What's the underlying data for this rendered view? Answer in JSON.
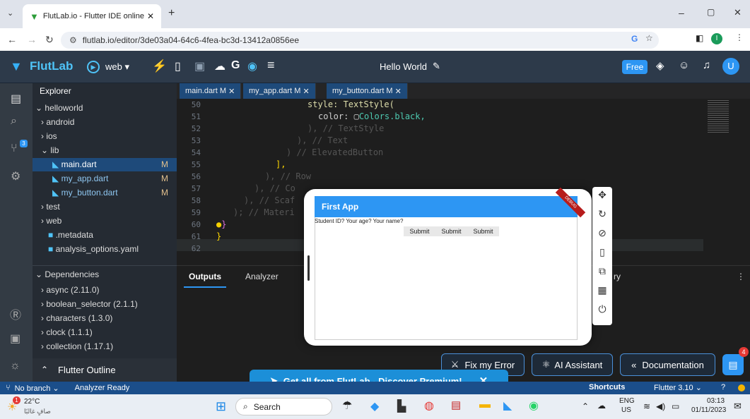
{
  "browser": {
    "tab_title": "FlutLab.io - Flutter IDE online",
    "url": "flutlab.io/editor/3de03a04-64c6-4fea-bc3d-13412a0856ee"
  },
  "app": {
    "brand": "FlutLab",
    "target": "web",
    "project_title": "Hello World",
    "plan": "Free",
    "avatar": "U"
  },
  "explorer": {
    "title": "Explorer",
    "root": "helloworld",
    "items": [
      "android",
      "ios",
      "lib",
      "main.dart",
      "my_app.dart",
      "my_button.dart",
      "test",
      "web",
      ".metadata",
      "analysis_options.yaml"
    ],
    "modified_flag": "M"
  },
  "dependencies": {
    "title": "Dependencies",
    "items": [
      "async (2.11.0)",
      "boolean_selector (2.1.1)",
      "characters (1.3.0)",
      "clock (1.1.1)",
      "collection (1.17.1)"
    ]
  },
  "outline": {
    "title": "Flutter Outline"
  },
  "editor_tabs": [
    "main.dart M",
    "my_app.dart M",
    "my_button.dart M"
  ],
  "code": {
    "lines": [
      "50",
      "51",
      "52",
      "53",
      "54",
      "55",
      "56",
      "57",
      "58",
      "59",
      "60",
      "61",
      "62"
    ],
    "l50": "style: TextStyle(",
    "l51a": "color: ",
    "l51b": "Colors.black,",
    "l52": "), // TextStyle",
    "l53": "), // Text",
    "l54": ") // ElevatedButton",
    "l55": "],",
    "l56": "), // Row",
    "l57": "), // Co",
    "l58": "), // Scaf",
    "l59": "); // Materi",
    "l60": "}",
    "l61": "}"
  },
  "bottom_tabs": {
    "outputs": "Outputs",
    "analyzer": "Analyzer",
    "other_tail": "ry"
  },
  "preview": {
    "app_title": "First App",
    "debug": "DEBUG",
    "text": "Student ID? Your age? Your name?",
    "buttons": [
      "Submit",
      "Submit",
      "Submit"
    ]
  },
  "actions": {
    "fix": "Fix my Error",
    "ai": "AI Assistant",
    "docs": "Documentation",
    "chat_badge": "4"
  },
  "premium": "Get all from FlutLab - Discover Premium!",
  "status": {
    "branch": "No branch",
    "analyzer": "Analyzer Ready",
    "shortcuts": "Shortcuts",
    "flutter": "Flutter 3.10"
  },
  "taskbar": {
    "temp": "22°C",
    "weather": "صافٍ غالبًا",
    "search": "Search",
    "lang1": "ENG",
    "lang2": "US",
    "time": "03:13",
    "date": "01/11/2023",
    "weather_badge": "1"
  },
  "source_control_badge": "3"
}
